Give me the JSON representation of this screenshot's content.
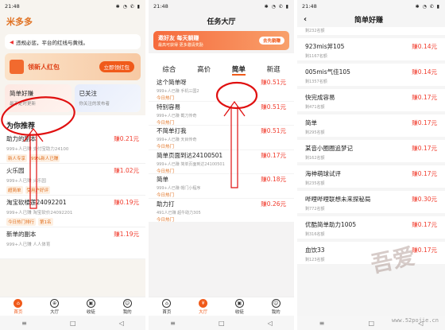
{
  "status": {
    "time": "21:48",
    "icons": "✱ ◔ ✆ ▮"
  },
  "colors": {
    "accent": "#f05a1a",
    "price": "#f03a2b",
    "annotation": "#e01010"
  },
  "p1": {
    "brand": "米多多",
    "notice": "违规必惩，平台的红线与黄线。",
    "banner": {
      "title": "领新人红包",
      "button": "立即领红包"
    },
    "cards": [
      {
        "title": "简单好赚",
        "sub": "最不定时更新"
      },
      {
        "title": "已关注",
        "sub": "你关注的发布者"
      }
    ],
    "section": "为你推荐",
    "items": [
      {
        "title": "助力的副本",
        "price": "赚0.21元",
        "meta": "999+人已赚   支付宝助力24100",
        "tags": [
          "新人专享",
          "99%新人已赚"
        ]
      },
      {
        "title": "火乐园",
        "price": "赚1.02元",
        "meta": "999+人已赚   火乐园",
        "tags": [
          "超简单",
          "受用户好评"
        ]
      },
      {
        "title": "淘宝砍楼莲24092201",
        "price": "赚0.19元",
        "meta": "999+人已赚   淘宝砍价24092201",
        "tags": [
          "今日热门排行",
          "第1名"
        ]
      },
      {
        "title": "新单的副本",
        "price": "赚1.19元",
        "meta": "999+人已赚   人人体育",
        "tags": []
      }
    ],
    "tabs": [
      "首页",
      "大厅",
      "收徒",
      "我的"
    ]
  },
  "p2": {
    "title": "任务大厅",
    "banner": {
      "title": "邀好友 每天躺赚",
      "sub": "最高可获得 更多邀请奖励",
      "button": "去先躺赚"
    },
    "tabs": [
      "综合",
      "高价",
      "简单",
      "新逛"
    ],
    "items": [
      {
        "title": "这个简单呀",
        "price": "赚0.51元",
        "meta": "999+人已赚   手机三国2",
        "hot": "今日热门"
      },
      {
        "title": "特别容易",
        "price": "赚0.51元",
        "meta": "999+人已赚   截刀传奇",
        "hot": "今日热门"
      },
      {
        "title": "不简单打我",
        "price": "赚0.51元",
        "meta": "999+人已赚   天目传奇",
        "hot": "今日热门"
      },
      {
        "title": "简单页面到达24100501",
        "price": "赚0.17元",
        "meta": "999+人已赚   简单页面到达24100501",
        "hot": "今日热门"
      },
      {
        "title": "简单",
        "price": "赚0.18元",
        "meta": "999+人已赚   帽门小程序",
        "hot": "今日热门"
      },
      {
        "title": "助力打",
        "price": "赚0.26元",
        "meta": "491人已赚   超牛助力305",
        "hot": "今日热门"
      }
    ],
    "tabbar": [
      "首页",
      "大厅",
      "收徒",
      "我的"
    ]
  },
  "p3": {
    "title": "简单好赚",
    "tail": "剩232名额",
    "items": [
      {
        "title": "923mis笄105",
        "price": "赚0.14元",
        "meta": "剩1167名额"
      },
      {
        "title": "005mis气佳105",
        "price": "赚0.14元",
        "meta": "剩1357名额"
      },
      {
        "title": "快完成容易",
        "price": "赚0.17元",
        "meta": "剩471名额"
      },
      {
        "title": "简单",
        "price": "赚0.17元",
        "meta": "剩295名额"
      },
      {
        "title": "某音小圈圈追梦记",
        "price": "赚0.17元",
        "meta": "剩162名额"
      },
      {
        "title": "海神萌球试评",
        "price": "赚0.17元",
        "meta": "剩235名额"
      },
      {
        "title": "哔哩哔哩联想未来探秘局",
        "price": "赚0.30元",
        "meta": "剩772名额"
      },
      {
        "title": "优酷简单助力1005",
        "price": "赚0.17元",
        "meta": "剩316名额"
      },
      {
        "title": "血饮33",
        "price": "赚0.17元",
        "meta": "剩123名额"
      }
    ]
  },
  "watermark": "www.52pojie.cn"
}
